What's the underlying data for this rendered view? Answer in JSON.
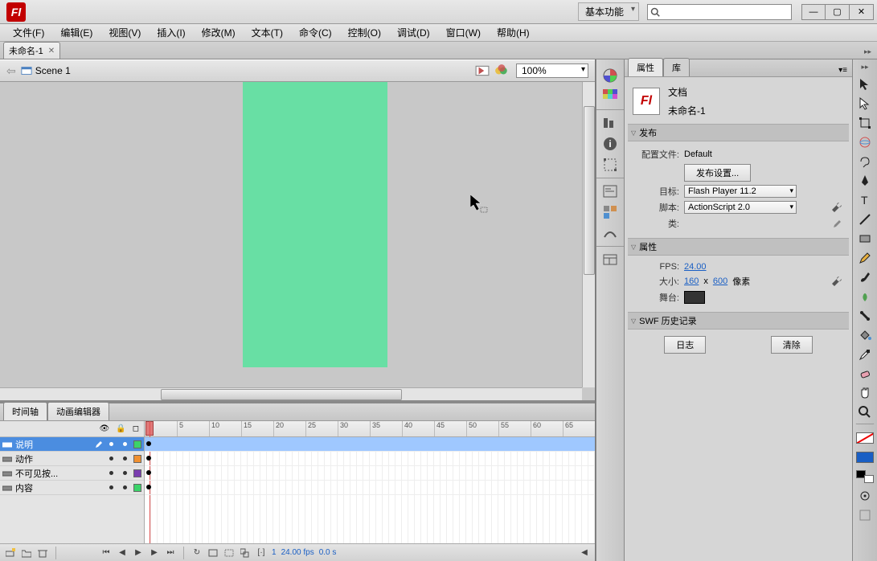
{
  "title_bar": {
    "logo": "Fl",
    "workspace": "基本功能",
    "search_placeholder": ""
  },
  "menu": [
    "文件(F)",
    "编辑(E)",
    "视图(V)",
    "插入(I)",
    "修改(M)",
    "文本(T)",
    "命令(C)",
    "控制(O)",
    "调试(D)",
    "窗口(W)",
    "帮助(H)"
  ],
  "doc_tab": {
    "name": "未命名-1"
  },
  "scene": {
    "name": "Scene 1",
    "zoom": "100%"
  },
  "timeline": {
    "tabs": [
      "时间轴",
      "动画编辑器"
    ],
    "ruler_marks": [
      5,
      10,
      15,
      20,
      25,
      30,
      35,
      40,
      45,
      50,
      55,
      60,
      65
    ],
    "layers": [
      {
        "name": "说明",
        "color": "#3bd36a",
        "selected": true
      },
      {
        "name": "动作",
        "color": "#f09030",
        "selected": false
      },
      {
        "name": "不可见按...",
        "color": "#7a3db0",
        "selected": false
      },
      {
        "name": "内容",
        "color": "#3bd36a",
        "selected": false
      }
    ],
    "footer": {
      "frame": "1",
      "fps": "24.00 fps",
      "time": "0.0 s"
    }
  },
  "props": {
    "tabs": [
      "属性",
      "库"
    ],
    "doc_type": "文档",
    "doc_name": "未命名-1",
    "sections": {
      "publish": {
        "title": "发布",
        "profile_label": "配置文件:",
        "profile_value": "Default",
        "settings_btn": "发布设置...",
        "target_label": "目标:",
        "target_value": "Flash Player 11.2",
        "script_label": "脚本:",
        "script_value": "ActionScript 2.0",
        "class_label": "类:",
        "class_value": ""
      },
      "attrs": {
        "title": "属性",
        "fps_label": "FPS:",
        "fps_value": "24.00",
        "size_label": "大小:",
        "width": "160",
        "x": "x",
        "height": "600",
        "unit": "像素",
        "stage_label": "舞台:"
      },
      "history": {
        "title": "SWF 历史记录",
        "log_btn": "日志",
        "clear_btn": "清除"
      }
    }
  },
  "tools": [
    "selection",
    "subselection",
    "free-transform",
    "3d-rotation",
    "lasso",
    "pen",
    "text",
    "line",
    "rectangle",
    "pencil",
    "brush",
    "deco",
    "bone",
    "paint-bucket",
    "eyedropper",
    "eraser",
    "hand",
    "zoom"
  ]
}
